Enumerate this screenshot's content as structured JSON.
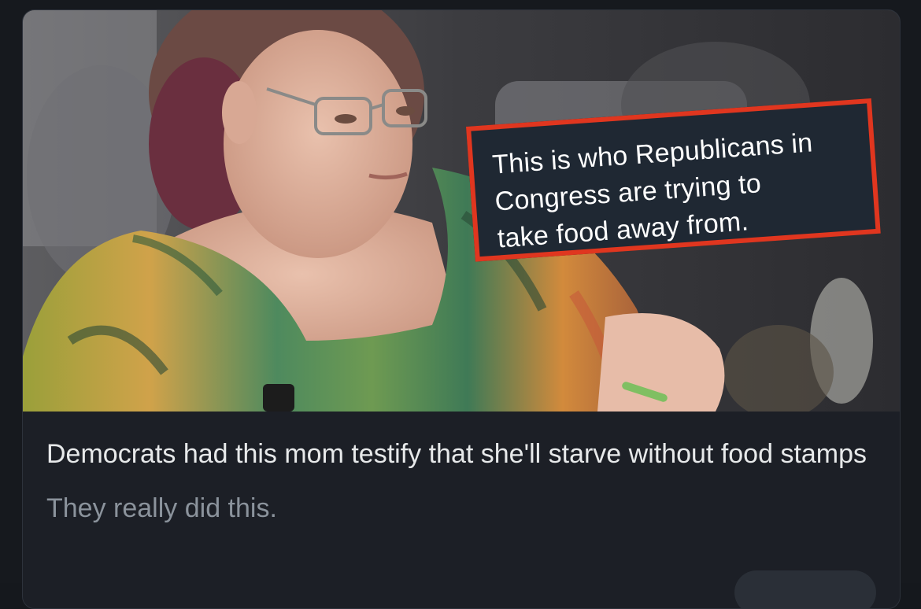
{
  "card": {
    "image": {
      "icon": "photo-thumbnail",
      "overlay_text": "This is who Republicans in Congress are trying to take food away from.",
      "overlay_lines": [
        "This is who Republicans in",
        "Congress are trying to",
        "take food away from."
      ],
      "overlay_border_color": "#e0361f"
    },
    "title": "Democrats had this mom testify that she'll starve without food stamps",
    "subtitle": "They really did this."
  }
}
